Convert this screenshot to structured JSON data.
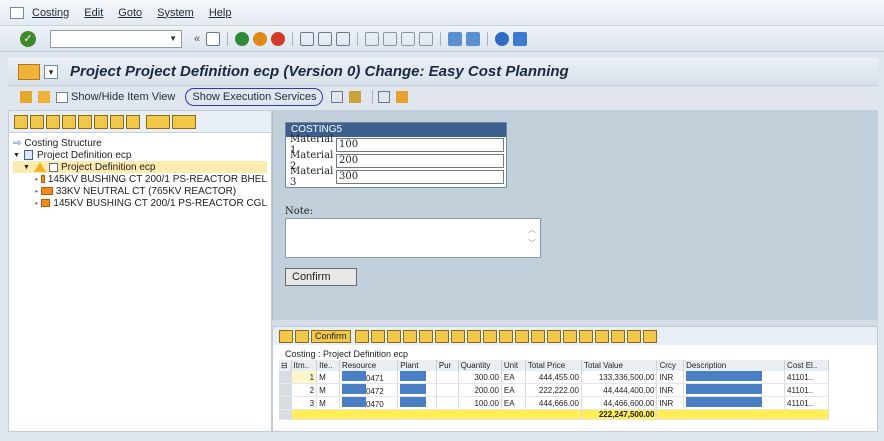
{
  "menu": [
    "Costing",
    "Edit",
    "Goto",
    "System",
    "Help"
  ],
  "title": "Project Project Definition ecp (Version 0) Change: Easy Cost Planning",
  "app_toolbar": {
    "show_hide": "Show/Hide Item View",
    "exec": "Show Execution Services"
  },
  "tree": {
    "root": "Costing Structure",
    "project": "Project Definition ecp",
    "selected": "Project Definition ecp",
    "items": [
      "145KV BUSHING CT 200/1 PS-REACTOR BHEL",
      "33KV NEUTRAL CT (765KV REACTOR)",
      "145KV BUSHING CT 200/1 PS-REACTOR CGL"
    ]
  },
  "costing": {
    "header": "COSTING5",
    "rows": [
      {
        "label": "Material 1",
        "value": "100"
      },
      {
        "label": "Material 2",
        "value": "200"
      },
      {
        "label": "Material 3",
        "value": "300"
      }
    ]
  },
  "note_label": "Note:",
  "confirm_label": "Confirm",
  "bottom": {
    "confirm_mini": "Confirm",
    "caption": "Costing : Project Definition ecp",
    "headers": [
      "Itm..",
      "Ite..",
      "Resource",
      "Plant",
      "Pur",
      "Quantity",
      "Unit",
      "Total Price",
      "Total Value",
      "Crcy",
      "Description",
      "Cost El.."
    ],
    "rows": [
      {
        "itm": "1",
        "ite": "M",
        "res": "0471",
        "qty": "300.00",
        "unit": "EA",
        "price": "444,455.00",
        "value": "133,336,500.00",
        "crcy": "INR",
        "cel": "41101.."
      },
      {
        "itm": "2",
        "ite": "M",
        "res": "0472",
        "qty": "200.00",
        "unit": "EA",
        "price": "222,222.00",
        "value": "44,444,400.00",
        "crcy": "INR",
        "cel": "41101.."
      },
      {
        "itm": "3",
        "ite": "M",
        "res": "0470",
        "qty": "100.00",
        "unit": "EA",
        "price": "444,666.00",
        "value": "44,466,600.00",
        "crcy": "INR",
        "cel": "41101.."
      }
    ],
    "total": "222,247,500.00"
  }
}
